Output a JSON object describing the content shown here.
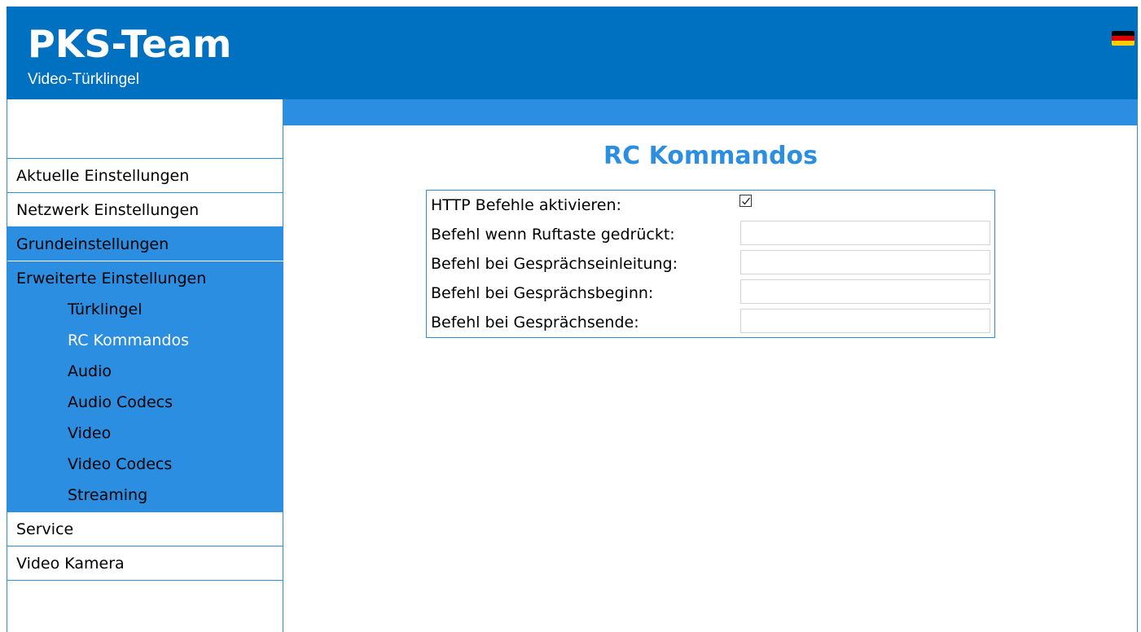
{
  "header": {
    "title": "PKS-Team",
    "subtitle": "Video-Türklingel",
    "flag_colors": [
      "#000000",
      "#dd0000",
      "#ffce00"
    ]
  },
  "sidebar": {
    "items": [
      {
        "label": "Aktuelle Einstellungen"
      },
      {
        "label": "Netzwerk Einstellungen"
      },
      {
        "label": "Grundeinstellungen"
      },
      {
        "label": "Erweiterte Einstellungen"
      },
      {
        "label": "Service"
      },
      {
        "label": "Video Kamera"
      }
    ],
    "subitems": [
      {
        "label": "Türklingel"
      },
      {
        "label": "RC Kommandos"
      },
      {
        "label": "Audio"
      },
      {
        "label": "Audio Codecs"
      },
      {
        "label": "Video"
      },
      {
        "label": "Video Codecs"
      },
      {
        "label": "Streaming"
      }
    ]
  },
  "main": {
    "title": "RC Kommandos",
    "form": {
      "http_label": "HTTP Befehle aktivieren:",
      "http_checked": true,
      "fields": [
        {
          "label": "Befehl wenn Ruftaste gedrückt:",
          "value": ""
        },
        {
          "label": "Befehl bei Gesprächseinleitung:",
          "value": ""
        },
        {
          "label": "Befehl bei Gesprächsbeginn:",
          "value": ""
        },
        {
          "label": "Befehl bei Gesprächsende:",
          "value": ""
        }
      ]
    }
  },
  "colors": {
    "header_bg": "#0070c0",
    "accent": "#2b8ee0"
  }
}
